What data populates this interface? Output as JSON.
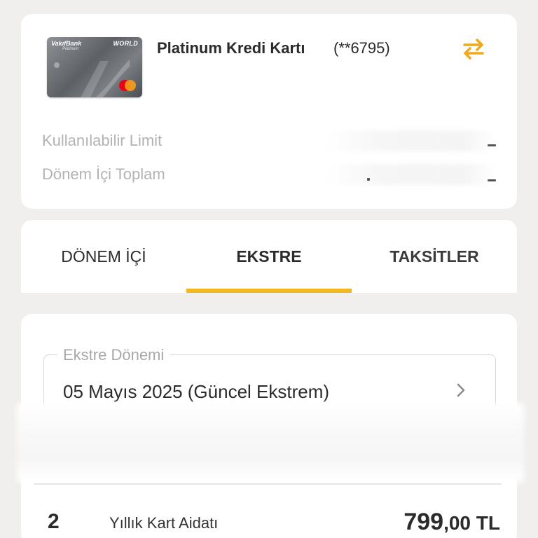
{
  "card": {
    "bank_brand": "VakıfBank",
    "bank_tier": "Platinum",
    "network_badge": "WORLD",
    "title": "Platinum Kredi Kartı",
    "masked_number": "(**6795)",
    "available_limit_label": "Kullanılabilir Limit",
    "period_total_label": "Dönem İçi Toplam",
    "accent_color": "#f2b81e"
  },
  "tabs": [
    {
      "label": "DÖNEM İÇİ",
      "selected": false
    },
    {
      "label": "EKSTRE",
      "selected": true
    },
    {
      "label": "TAKSİTLER",
      "selected": false
    }
  ],
  "statement": {
    "period_label": "Ekstre Dönemi",
    "period_value": "05 Mayıs 2025 (Güncel Ekstrem)",
    "row": {
      "count": "2",
      "description": "Yıllık Kart Aidatı",
      "amount_main": "799",
      "amount_decimal": ",00 TL"
    }
  },
  "icons": {
    "swap": "swap-arrows-icon",
    "chevron": "chevron-right-icon"
  }
}
